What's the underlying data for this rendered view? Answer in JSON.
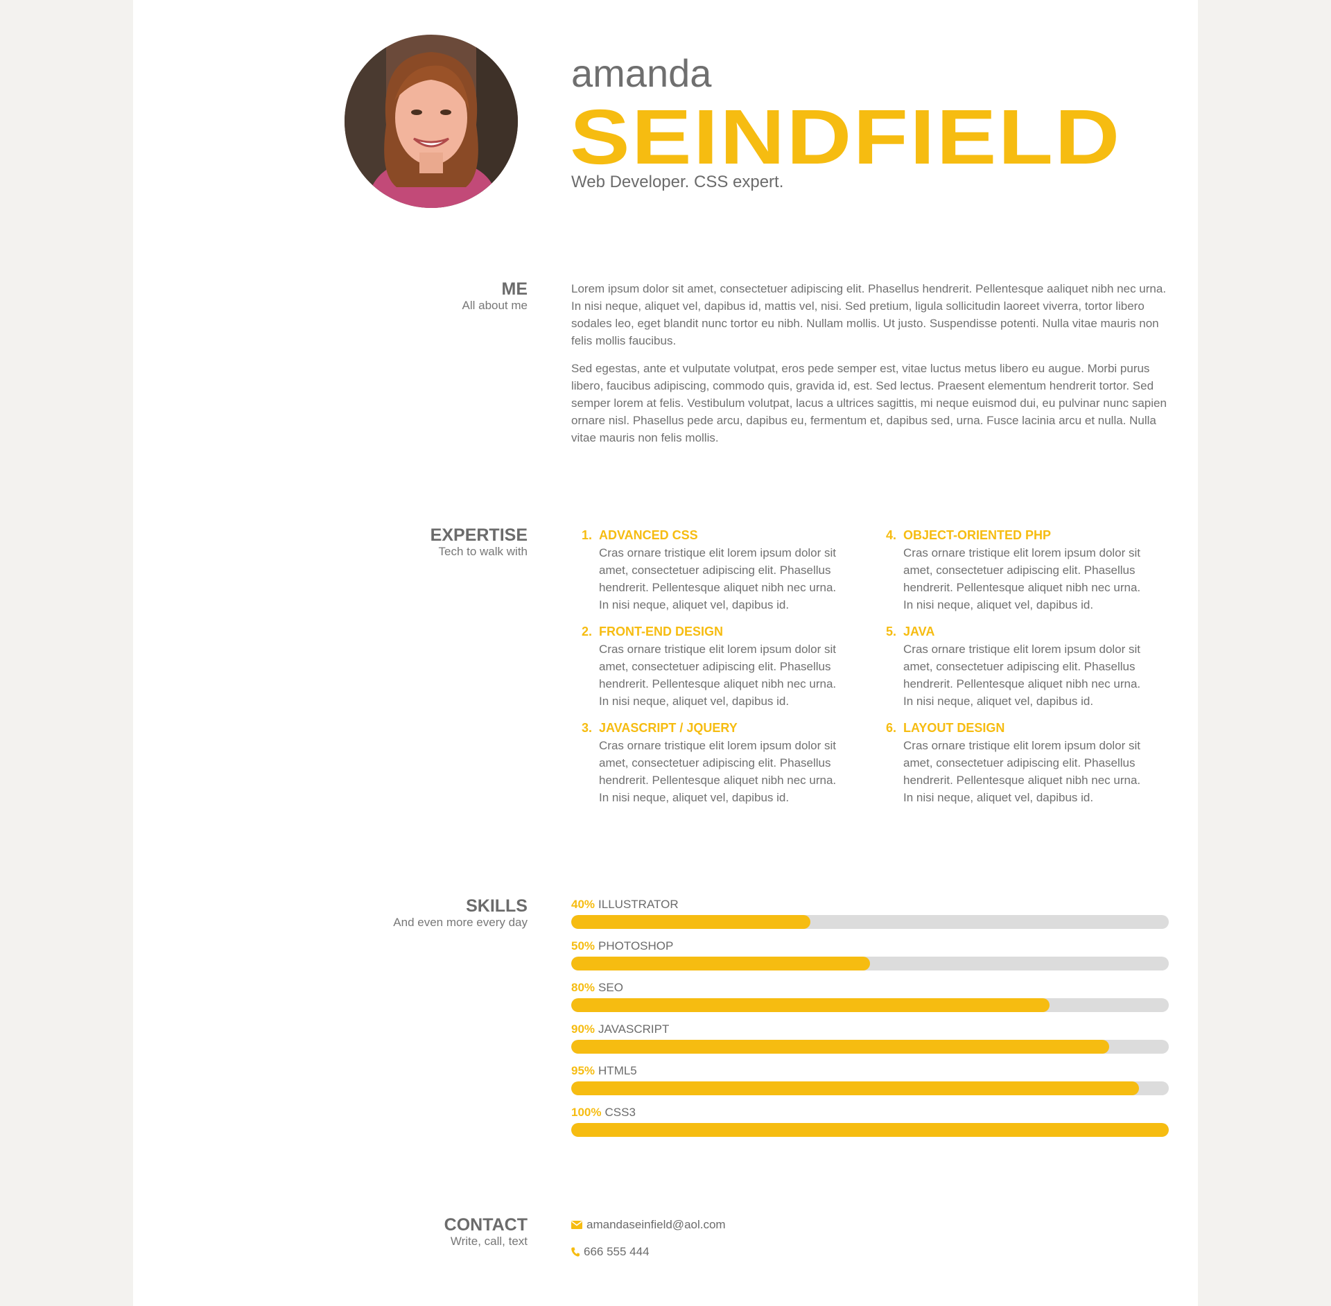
{
  "header": {
    "first_name": "amanda",
    "last_name": "SEINDFIELD",
    "tagline": "Web Developer. CSS expert."
  },
  "colors": {
    "accent": "#f6bc11",
    "text": "#6b6b6b",
    "bar_track": "#dcdcdc",
    "background": "#f3f2ef"
  },
  "sections": {
    "me": {
      "title": "ME",
      "subtitle": "All about me"
    },
    "expertise": {
      "title": "EXPERTISE",
      "subtitle": "Tech to walk with"
    },
    "skills": {
      "title": "SKILLS",
      "subtitle": "And even more every day"
    },
    "contact": {
      "title": "CONTACT",
      "subtitle": "Write, call, text"
    }
  },
  "about": {
    "paragraphs": [
      "Lorem ipsum dolor sit amet, consectetuer adipiscing elit. Phasellus hendrerit. Pellentesque aaliquet nibh nec urna. In nisi neque, aliquet vel, dapibus id, mattis vel, nisi. Sed pretium, ligula sollicitudin laoreet viverra, tortor libero sodales leo, eget blandit nunc tortor eu nibh. Nullam mollis. Ut justo. Suspendisse potenti. Nulla vitae mauris non felis mollis faucibus.",
      "Sed egestas, ante et vulputate volutpat, eros pede semper est, vitae luctus metus libero eu augue. Morbi purus libero, faucibus adipiscing, commodo quis, gravida id, est. Sed lectus. Praesent elementum hendrerit tortor. Sed semper lorem at felis. Vestibulum volutpat, lacus a ultrices sagittis, mi neque euismod dui, eu pulvinar nunc sapien ornare nisl. Phasellus pede arcu, dapibus eu, fermentum et, dapibus sed, urna. Fusce lacinia arcu et nulla. Nulla vitae mauris non felis mollis."
    ]
  },
  "expertise": [
    {
      "num": "1.",
      "title": "ADVANCED CSS",
      "text": "Cras ornare tristique elit lorem ipsum dolor sit amet, consectetuer adipiscing elit. Phasellus hendrerit. Pellentesque aliquet nibh nec urna. In nisi neque, aliquet vel, dapibus id."
    },
    {
      "num": "2.",
      "title": "FRONT-END DESIGN",
      "text": "Cras ornare tristique elit lorem ipsum dolor sit amet, consectetuer adipiscing elit. Phasellus hendrerit. Pellentesque aliquet nibh nec urna. In nisi neque, aliquet vel, dapibus id."
    },
    {
      "num": "3.",
      "title": "JAVASCRIPT / JQUERY",
      "text": "Cras ornare tristique elit lorem ipsum dolor sit amet, consectetuer adipiscing elit. Phasellus hendrerit. Pellentesque aliquet nibh nec urna. In nisi neque, aliquet vel, dapibus id."
    },
    {
      "num": "4.",
      "title": "OBJECT-ORIENTED PHP",
      "text": "Cras ornare tristique elit lorem ipsum dolor sit amet, consectetuer adipiscing elit. Phasellus hendrerit. Pellentesque aliquet nibh nec urna. In nisi neque, aliquet vel, dapibus id."
    },
    {
      "num": "5.",
      "title": "JAVA",
      "text": "Cras ornare tristique elit lorem ipsum dolor sit amet, consectetuer adipiscing elit. Phasellus hendrerit. Pellentesque aliquet nibh nec urna. In nisi neque, aliquet vel, dapibus id."
    },
    {
      "num": "6.",
      "title": "LAYOUT DESIGN",
      "text": "Cras ornare tristique elit lorem ipsum dolor sit amet, consectetuer adipiscing elit. Phasellus hendrerit. Pellentesque aliquet nibh nec urna. In nisi neque, aliquet vel, dapibus id."
    }
  ],
  "skills": [
    {
      "percent": "40%",
      "name": "ILLUSTRATOR",
      "value": 0.4
    },
    {
      "percent": "50%",
      "name": "PHOTOSHOP",
      "value": 0.5
    },
    {
      "percent": "80%",
      "name": "SEO",
      "value": 0.8
    },
    {
      "percent": "90%",
      "name": "JAVASCRIPT",
      "value": 0.9
    },
    {
      "percent": "95%",
      "name": "HTML5",
      "value": 0.95
    },
    {
      "percent": "100%",
      "name": "CSS3",
      "value": 1.0
    }
  ],
  "contact": {
    "email": "amandaseinfield@aol.com",
    "phone": "666 555 444",
    "email_icon": "envelope-icon",
    "phone_icon": "phone-icon"
  }
}
